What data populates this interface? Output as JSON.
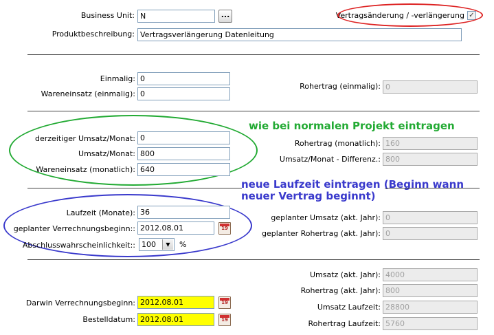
{
  "header": {
    "business_unit_label": "Business Unit:",
    "business_unit_value": "N",
    "browse_button_label": "...",
    "produktbeschreibung_label": "Produktbeschreibung:",
    "produktbeschreibung_value": "Vertragsverlängerung Datenleitung",
    "vertragsaenderung_label": "Vertragsänderung / -verlängerung",
    "vertragsaenderung_checked": "✓"
  },
  "einmalig": {
    "einmalig_label": "Einmalig:",
    "einmalig_value": "0",
    "wareneinsatz_label": "Wareneinsatz (einmalig):",
    "wareneinsatz_value": "0",
    "rohertrag_label": "Rohertrag (einmalig):",
    "rohertrag_value": "0"
  },
  "monatlich": {
    "derzeitiger_label": "derzeitiger Umsatz/Monat:",
    "derzeitiger_value": "0",
    "umsatz_label": "Umsatz/Monat:",
    "umsatz_value": "800",
    "wareneinsatz_label": "Wareneinsatz (monatlich):",
    "wareneinsatz_value": "640",
    "rohertrag_label": "Rohertrag (monatlich):",
    "rohertrag_value": "160",
    "differenz_label": "Umsatz/Monat - Differenz.:",
    "differenz_value": "800"
  },
  "laufzeit": {
    "laufzeit_label": "Laufzeit (Monate):",
    "laufzeit_value": "36",
    "verrechnungsbeginn_label": "geplanter Verrechnungsbeginn::",
    "verrechnungsbeginn_value": "2012.08.01",
    "abschluss_label": "Abschlusswahrscheinlichkeit::",
    "abschluss_value": "100",
    "abschluss_unit": "%",
    "geplanter_umsatz_label": "geplanter Umsatz (akt. Jahr):",
    "geplanter_umsatz_value": "0",
    "geplanter_rohertrag_label": "geplanter Rohertrag (akt. Jahr):",
    "geplanter_rohertrag_value": "0"
  },
  "darwin": {
    "darwin_label": "Darwin Verrechnungsbeginn:",
    "darwin_value": "2012.08.01",
    "bestelldatum_label": "Bestelldatum:",
    "bestelldatum_value": "2012.08.01",
    "umsatz_jahr_label": "Umsatz (akt. Jahr):",
    "umsatz_jahr_value": "4000",
    "rohertrag_jahr_label": "Rohertrag (akt. Jahr):",
    "rohertrag_jahr_value": "800",
    "umsatz_laufzeit_label": "Umsatz Laufzeit:",
    "umsatz_laufzeit_value": "28800",
    "rohertrag_laufzeit_label": "Rohertrag Laufzeit:",
    "rohertrag_laufzeit_value": "5760"
  },
  "calendar_icon_text": "19",
  "annotations": {
    "green_text": "wie bei normalen Projekt eintragen",
    "blue_text_line1": "neue Laufzeit eintragen (Beginn wann",
    "blue_text_line2": "neuer Vertrag beginnt)",
    "green_color": "#22aa33",
    "blue_color": "#3a3acc",
    "red_color": "#dd2222"
  }
}
